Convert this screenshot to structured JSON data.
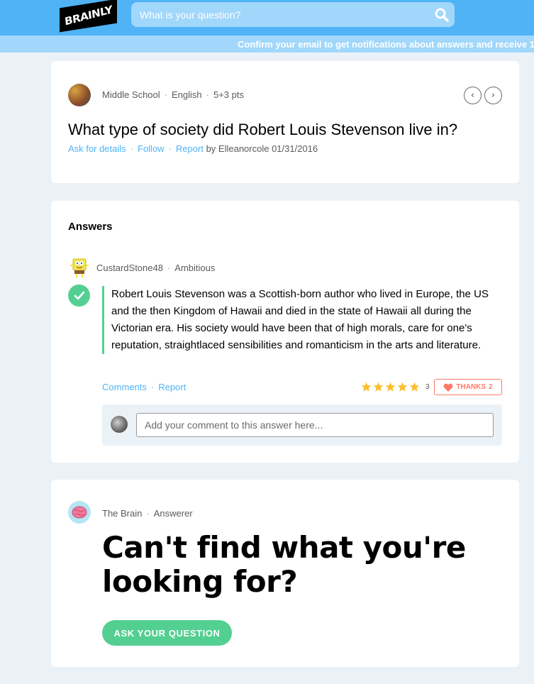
{
  "header": {
    "logo_text": "BRAINLY",
    "search_placeholder": "What is your question?",
    "notice": "Confirm your email to get notifications about answers and receive 1"
  },
  "question": {
    "subject": "Middle School",
    "language": "English",
    "points": "5+3 pts",
    "title": "What type of society did Robert Louis Stevenson live in?",
    "ask_details": "Ask for details",
    "follow": "Follow",
    "report": "Report",
    "by_text": "by Elleanorcole 01/31/2016",
    "prev_icon": "chevron-left-icon",
    "next_icon": "chevron-right-icon"
  },
  "answers": {
    "heading": "Answers",
    "author": "CustardStone48",
    "rank": "Ambitious",
    "body": "Robert Louis Stevenson was a Scottish-born author who lived in Europe, the US and the then Kingdom of Hawaii and died in  the state of Hawaii all during the Victorian era. His society would have been that of high morals, care for one's reputation, straightlaced sensibilities and romanticism in the arts and literature.",
    "comments": "Comments",
    "report": "Report",
    "rating_stars": 5,
    "rating_count": "3",
    "thanks_label": "THANKS",
    "thanks_count": "2",
    "comment_placeholder": "Add your comment to this answer here...",
    "accent": "#53cf92"
  },
  "cta": {
    "author": "The Brain",
    "rank": "Answerer",
    "title": "Can't find what you're looking for?",
    "button": "ASK YOUR QUESTION"
  },
  "colors": {
    "top_bar": "#4fb3f6",
    "link": "#4fb3f6",
    "green": "#53cf92",
    "star": "#fbbe2e",
    "thanks": "#ff7968"
  }
}
